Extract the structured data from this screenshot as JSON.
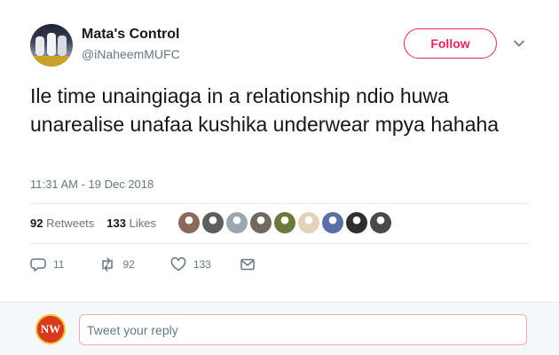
{
  "author": {
    "name": "Mata's Control",
    "handle": "@iNaheemMUFC"
  },
  "follow_label": "Follow",
  "tweet": {
    "text": "Ile time unaingiaga in a relationship ndio huwa unarealise unafaa kushika underwear mpya hahaha",
    "timestamp": "11:31 AM - 19 Dec 2018"
  },
  "stats": {
    "retweets_count": "92",
    "retweets_label": "Retweets",
    "likes_count": "133",
    "likes_label": "Likes"
  },
  "liker_avatars": [
    "#8c6a5a",
    "#5c5f5a",
    "#9aa7b3",
    "#6f6a61",
    "#6b7a3a",
    "#e3d3b8",
    "#5a6fa8",
    "#2f2f2f",
    "#4a4a4a"
  ],
  "actions": {
    "reply_count": "11",
    "retweet_count": "92",
    "like_count": "133"
  },
  "reply": {
    "avatar_text": "NW",
    "placeholder": "Tweet your reply"
  },
  "colors": {
    "accent": "#e0245e",
    "muted": "#657786",
    "text": "#14171a",
    "divider": "#e6ecf0"
  }
}
